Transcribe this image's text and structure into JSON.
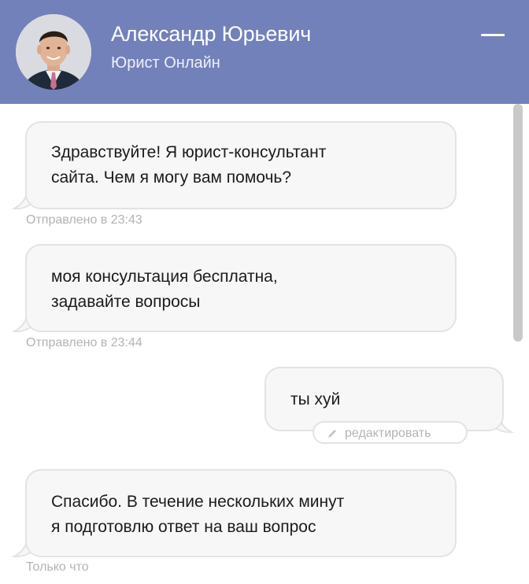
{
  "header": {
    "agent_name": "Александр Юрьевич",
    "agent_status": "Юрист Онлайн",
    "avatar_icon": "person-photo",
    "minimize_icon": "minimize-icon",
    "background_color": "#7381ba"
  },
  "messages": [
    {
      "sender": "agent",
      "text": "Здравствуйте! Я юрист-консультант\nсайта. Чем я могу вам помочь?",
      "meta": "Отправлено в 23:43"
    },
    {
      "sender": "agent",
      "text": "моя консультация бесплатна,\nзадавайте вопросы",
      "meta": "Отправлено в 23:44"
    },
    {
      "sender": "user",
      "text": "ты хуй",
      "action_label": "редактировать",
      "action_icon": "pencil-icon"
    },
    {
      "sender": "agent",
      "text": "Спасибо. В течение нескольких минут\nя подготовлю ответ на ваш вопрос",
      "meta": "Только что"
    }
  ]
}
